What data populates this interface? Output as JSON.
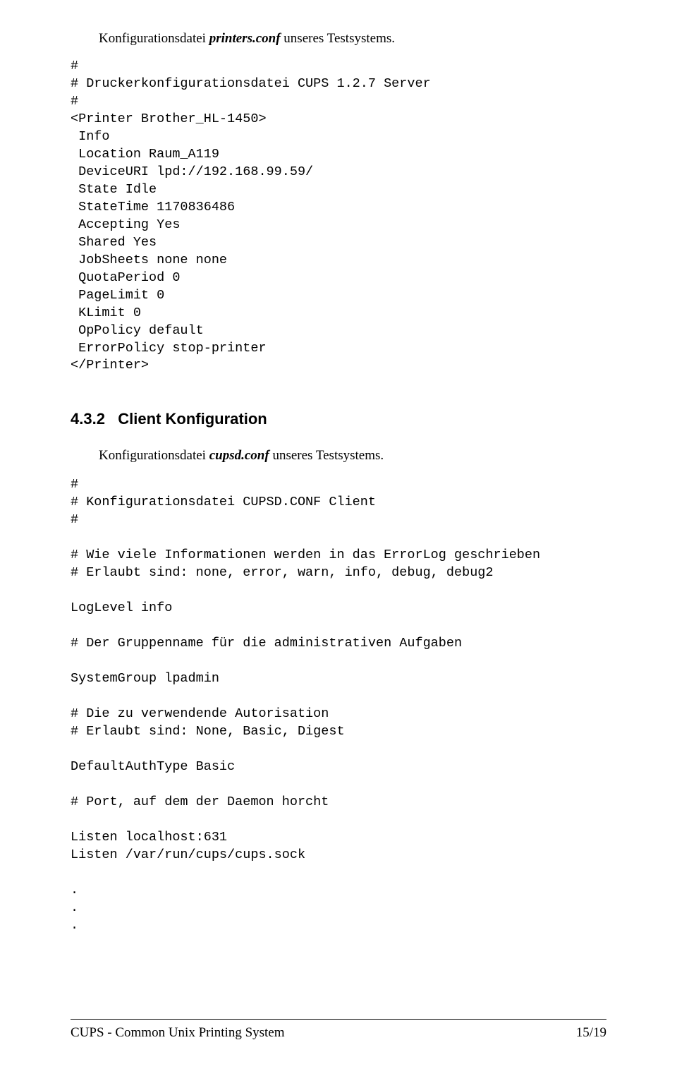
{
  "intro1_plain": "Konfigurationsdatei ",
  "intro1_italic": "printers.conf",
  "intro1_tail": " unseres Testsystems.",
  "code1": "#\n# Druckerkonfigurationsdatei CUPS 1.2.7 Server\n#\n<Printer Brother_HL-1450>\n Info\n Location Raum_A119\n DeviceURI lpd://192.168.99.59/\n State Idle\n StateTime 1170836486\n Accepting Yes\n Shared Yes\n JobSheets none none\n QuotaPeriod 0\n PageLimit 0\n KLimit 0\n OpPolicy default\n ErrorPolicy stop-printer\n</Printer>",
  "section_num": "4.3.2",
  "section_title": "Client Konfiguration",
  "intro2_plain": "Konfigurationsdatei ",
  "intro2_italic": "cupsd.conf",
  "intro2_tail": " unseres Testsystems.",
  "code2": "#\n# Konfigurationsdatei CUPSD.CONF Client\n#\n\n# Wie viele Informationen werden in das ErrorLog geschrieben\n# Erlaubt sind: none, error, warn, info, debug, debug2\n\nLogLevel info\n\n# Der Gruppenname für die administrativen Aufgaben\n\nSystemGroup lpadmin\n\n# Die zu verwendende Autorisation\n# Erlaubt sind: None, Basic, Digest\n\nDefaultAuthType Basic\n\n# Port, auf dem der Daemon horcht\n\nListen localhost:631\nListen /var/run/cups/cups.sock\n\n.\n.\n.",
  "footer_left": "CUPS - Common Unix Printing System",
  "footer_right": "15/19"
}
